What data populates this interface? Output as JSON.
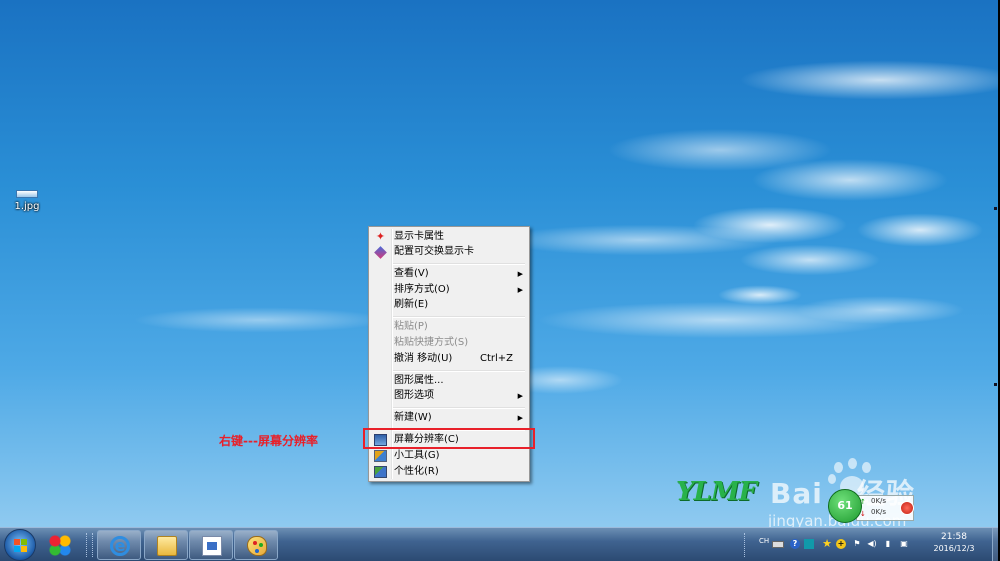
{
  "desktop": {
    "icon_label": "1.jpg"
  },
  "context_menu": {
    "items": [
      {
        "label": "显示卡属性",
        "disabled": false,
        "icon": "intel-graphics-icon"
      },
      {
        "label": "配置可交换显示卡",
        "disabled": false,
        "icon": "switchable-graphics-icon"
      },
      {
        "label": "查看(V)",
        "disabled": false,
        "submenu": true
      },
      {
        "label": "排序方式(O)",
        "disabled": false,
        "submenu": true
      },
      {
        "label": "刷新(E)",
        "disabled": false
      },
      {
        "label": "粘贴(P)",
        "disabled": true
      },
      {
        "label": "粘贴快捷方式(S)",
        "disabled": true
      },
      {
        "label": "撤消 移动(U)",
        "disabled": false,
        "shortcut": "Ctrl+Z"
      },
      {
        "label": "图形属性...",
        "disabled": false
      },
      {
        "label": "图形选项",
        "disabled": false,
        "submenu": true
      },
      {
        "label": "新建(W)",
        "disabled": false,
        "submenu": true
      },
      {
        "label": "屏幕分辨率(C)",
        "disabled": false,
        "icon": "screen-resolution-icon",
        "highlighted": true
      },
      {
        "label": "小工具(G)",
        "disabled": false,
        "icon": "gadgets-icon"
      },
      {
        "label": "个性化(R)",
        "disabled": false,
        "icon": "personalize-icon"
      }
    ],
    "submenu_arrow": "▶"
  },
  "annotation": {
    "text": "右键---屏幕分辨率",
    "color": "#e8202a"
  },
  "wallpaper": {
    "logo_text": "YLMF"
  },
  "watermark": {
    "brand": "Bai",
    "brand_tail": "经验",
    "url": "jingyan.baidu.com"
  },
  "speed_widget": {
    "ball_label": "61",
    "up_rate": "0K/s",
    "down_rate": "0K/s",
    "up_arrow": "↑",
    "down_arrow": "↓"
  },
  "taskbar": {
    "ie_glyph": "e",
    "tray": {
      "language": "CH",
      "help_glyph": "?",
      "star_glyph": "★",
      "plus_glyph": "+",
      "flag_glyph": "⚑",
      "volume_glyph": "◀)",
      "network_glyph": "▮",
      "usb_glyph": "▣"
    },
    "clock_time": "21:58",
    "clock_date": "2016/12/3"
  }
}
